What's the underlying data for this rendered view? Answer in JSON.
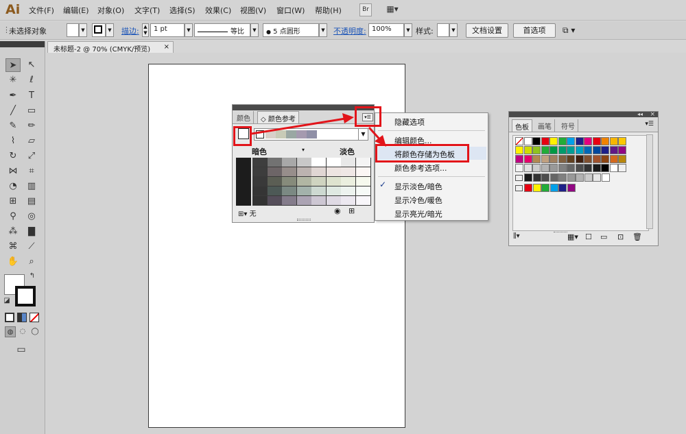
{
  "app": {
    "logo": "Ai",
    "menu": [
      "文件(F)",
      "编辑(E)",
      "对象(O)",
      "文字(T)",
      "选择(S)",
      "效果(C)",
      "视图(V)",
      "窗口(W)",
      "帮助(H)"
    ],
    "bridge_label": "Br",
    "layout_label": "▦▾"
  },
  "control": {
    "no_selection": "未选择对象",
    "stroke_label": "描边:",
    "stroke_value": "1 pt",
    "profile_value": "等比",
    "brush_value": "5 点圆形",
    "opacity_label": "不透明度:",
    "opacity_value": "100%",
    "style_label": "样式:",
    "doc_setup": "文档设置",
    "preferences": "首选项"
  },
  "document": {
    "tab_title": "未标题-2 @ 70% (CMYK/预览)",
    "close": "×"
  },
  "color_guide": {
    "tab_color": "颜色",
    "tab_guide": "颜色参考",
    "dark_label": "暗色",
    "light_label": "淡色",
    "footer_none": "无",
    "harmony": [
      "#d8d0c9",
      "#c8cbb7",
      "#9aa7a3",
      "#a59aaf",
      "#8f8fa6"
    ],
    "grid_rows": [
      [
        "#3e3e3e",
        "#727272",
        "#a8a8a8",
        "#c8c8c8",
        "#ffffff",
        "#ffffff",
        "#e8e8e8",
        "#f4f4f4"
      ],
      [
        "#3d3d3d",
        "#6d6567",
        "#978e8b",
        "#bcb3b0",
        "#e0d6d3",
        "#ede4e1",
        "#efe7e5",
        "#fbf6f4"
      ],
      [
        "#393939",
        "#5b5e54",
        "#868b7b",
        "#b1b6a3",
        "#cfd4c0",
        "#dee3cf",
        "#ebefdf",
        "#f6f9ee"
      ],
      [
        "#353535",
        "#4d5956",
        "#7b8983",
        "#a3b2ab",
        "#cdd9d1",
        "#dfe9e2",
        "#edf3ef",
        "#f6faf7"
      ],
      [
        "#333333",
        "#554e5a",
        "#847c8b",
        "#aba3b3",
        "#cdc7d3",
        "#dfdae4",
        "#ece8f0",
        "#f8f6fa"
      ]
    ]
  },
  "flyout": {
    "items": [
      "隐藏选项",
      "编辑颜色...",
      "将颜色存储为色板",
      "颜色参考选项...",
      "显示淡色/暗色",
      "显示冷色/暖色",
      "显示亮光/暗光"
    ],
    "checked_index": 4
  },
  "swatches": {
    "tab_swatches": "色板",
    "tab_brushes": "画笔",
    "tab_symbols": "符号",
    "rows": [
      [
        "none",
        "#ffffff",
        "#000000",
        "#e60012",
        "#fff100",
        "#22ac38",
        "#00a0e9",
        "#1d2088",
        "#e4007f",
        "#e60012",
        "#f08300",
        "#f8b500",
        "#fcc800"
      ],
      [
        "#fff100",
        "#cfdb00",
        "#8fc31f",
        "#22ac38",
        "#009944",
        "#009b6b",
        "#009e96",
        "#00a0c1",
        "#0068b7",
        "#00479d",
        "#1d2088",
        "#601986",
        "#920783"
      ],
      [
        "#be0081",
        "#e5006a",
        "#b28850",
        "#c0a080",
        "#a08060",
        "#806040",
        "#604020",
        "#402010",
        "#805030",
        "#a0522d",
        "#8b4513",
        "#d2691e",
        "#b8860b"
      ],
      [
        "#f2f2f2",
        "#e0e0e0",
        "#cccccc",
        "#b3b3b3",
        "#999999",
        "#808080",
        "#666666",
        "#4d4d4d",
        "#333333",
        "#1a1a1a",
        "#000000",
        "#ffffff",
        "#f0f0f0"
      ]
    ],
    "gray_row": [
      "#1a1a1a",
      "#333333",
      "#4d4d4d",
      "#666666",
      "#808080",
      "#999999",
      "#b3b3b3",
      "#cccccc",
      "#e6e6e6",
      "#ffffff"
    ],
    "color_row": [
      "#e60012",
      "#fff100",
      "#22ac38",
      "#00a0e9",
      "#1d2088",
      "#920783"
    ]
  }
}
